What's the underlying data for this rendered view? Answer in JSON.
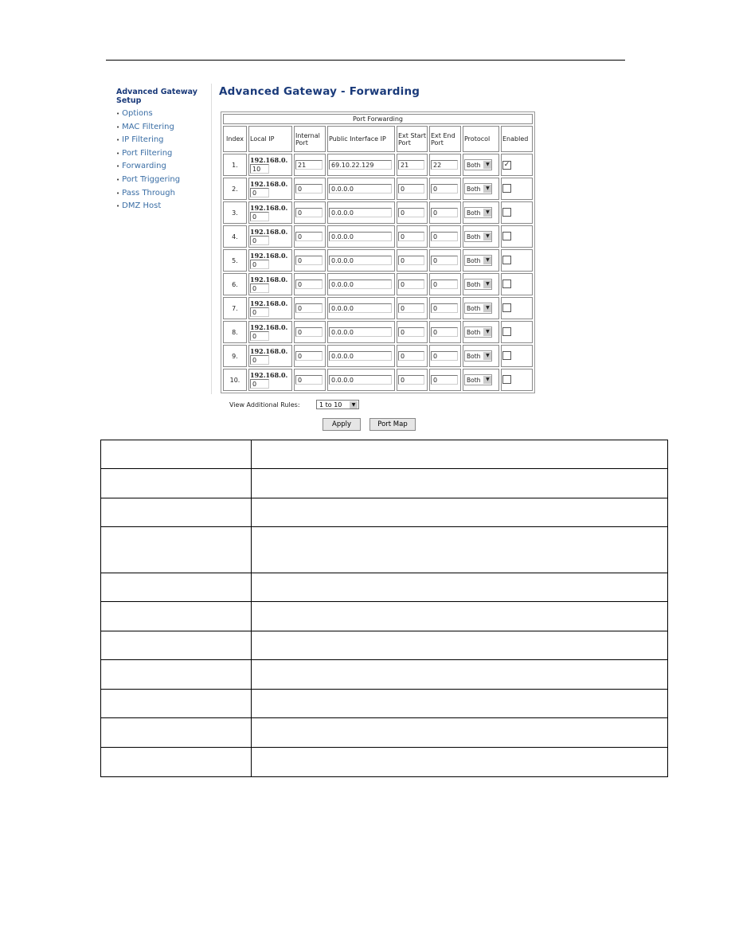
{
  "sidebar": {
    "title": "Advanced Gateway Setup",
    "items": [
      {
        "label": "Options"
      },
      {
        "label": "MAC Filtering"
      },
      {
        "label": "IP Filtering"
      },
      {
        "label": "Port Filtering"
      },
      {
        "label": "Forwarding"
      },
      {
        "label": "Port Triggering"
      },
      {
        "label": "Pass Through"
      },
      {
        "label": "DMZ Host"
      }
    ]
  },
  "page_title": "Advanced Gateway - Forwarding",
  "table": {
    "caption": "Port Forwarding",
    "headers": [
      "Index",
      "Local IP",
      "Internal Port",
      "Public Interface IP",
      "Ext Start Port",
      "Ext End Port",
      "Protocol",
      "Enabled"
    ],
    "ip_prefix": "192.168.0.",
    "rows": [
      {
        "index": "1.",
        "local_ip": "10",
        "internal_port": "21",
        "public_ip": "69.10.22.129",
        "ext_start": "21",
        "ext_end": "22",
        "protocol": "Both",
        "enabled": true
      },
      {
        "index": "2.",
        "local_ip": "0",
        "internal_port": "0",
        "public_ip": "0.0.0.0",
        "ext_start": "0",
        "ext_end": "0",
        "protocol": "Both",
        "enabled": false
      },
      {
        "index": "3.",
        "local_ip": "0",
        "internal_port": "0",
        "public_ip": "0.0.0.0",
        "ext_start": "0",
        "ext_end": "0",
        "protocol": "Both",
        "enabled": false
      },
      {
        "index": "4.",
        "local_ip": "0",
        "internal_port": "0",
        "public_ip": "0.0.0.0",
        "ext_start": "0",
        "ext_end": "0",
        "protocol": "Both",
        "enabled": false
      },
      {
        "index": "5.",
        "local_ip": "0",
        "internal_port": "0",
        "public_ip": "0.0.0.0",
        "ext_start": "0",
        "ext_end": "0",
        "protocol": "Both",
        "enabled": false
      },
      {
        "index": "6.",
        "local_ip": "0",
        "internal_port": "0",
        "public_ip": "0.0.0.0",
        "ext_start": "0",
        "ext_end": "0",
        "protocol": "Both",
        "enabled": false
      },
      {
        "index": "7.",
        "local_ip": "0",
        "internal_port": "0",
        "public_ip": "0.0.0.0",
        "ext_start": "0",
        "ext_end": "0",
        "protocol": "Both",
        "enabled": false
      },
      {
        "index": "8.",
        "local_ip": "0",
        "internal_port": "0",
        "public_ip": "0.0.0.0",
        "ext_start": "0",
        "ext_end": "0",
        "protocol": "Both",
        "enabled": false
      },
      {
        "index": "9.",
        "local_ip": "0",
        "internal_port": "0",
        "public_ip": "0.0.0.0",
        "ext_start": "0",
        "ext_end": "0",
        "protocol": "Both",
        "enabled": false
      },
      {
        "index": "10.",
        "local_ip": "0",
        "internal_port": "0",
        "public_ip": "0.0.0.0",
        "ext_start": "0",
        "ext_end": "0",
        "protocol": "Both",
        "enabled": false
      }
    ]
  },
  "view_rules": {
    "label": "View Additional Rules:",
    "value": "1 to 10"
  },
  "buttons": {
    "apply": "Apply",
    "port_map": "Port Map"
  }
}
